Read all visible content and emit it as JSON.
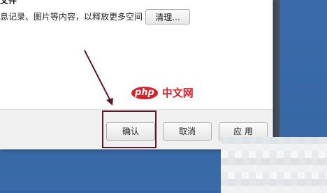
{
  "dialog": {
    "section_heading": "文件",
    "info_text": "息记录、图片等内容，以释放更多空间",
    "clean_button_label": "清理...",
    "buttons": {
      "ok": "确认",
      "cancel": "取消",
      "apply": "应 用"
    }
  },
  "watermark": {
    "logo": "php",
    "text": "中文网"
  },
  "colors": {
    "desktop": "#3565a5",
    "highlight": "#5a1a2a",
    "arrow": "#5a1a2a",
    "watermark": "#d8222a"
  }
}
